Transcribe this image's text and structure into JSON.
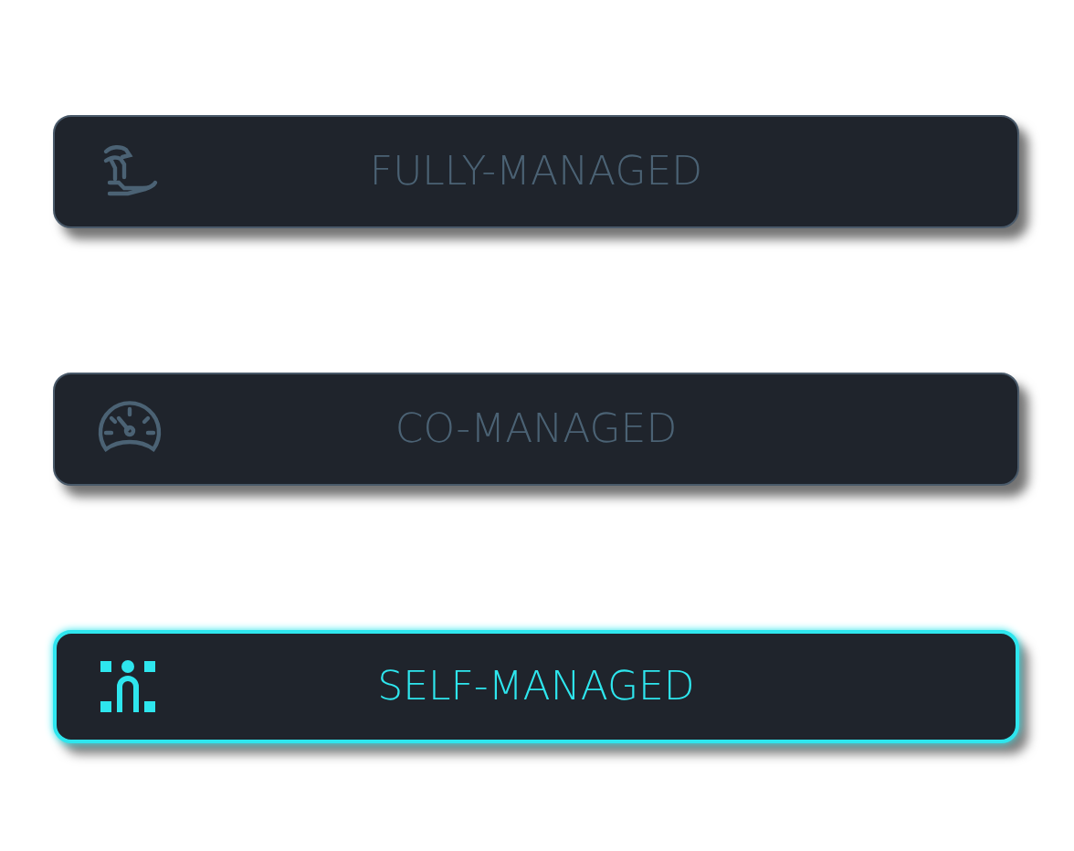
{
  "options": [
    {
      "label": "FULLY-MANAGED",
      "selected": false
    },
    {
      "label": "CO-MANAGED",
      "selected": false
    },
    {
      "label": "SELF-MANAGED",
      "selected": true
    }
  ]
}
